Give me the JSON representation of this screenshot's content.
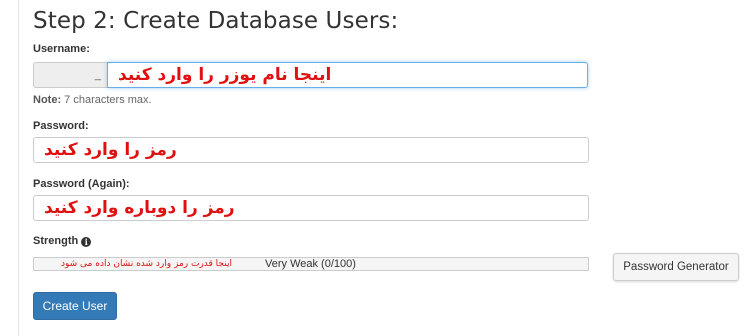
{
  "heading": "Step 2: Create Database Users:",
  "username": {
    "label": "Username:",
    "prefix": "_",
    "value": "اینجا نام یوزر را وارد کنید",
    "note_bold": "Note:",
    "note_text": " 7 characters max."
  },
  "password": {
    "label": "Password:",
    "value": "رمز را وارد کنید"
  },
  "password_again": {
    "label": "Password (Again):",
    "value": "رمز را دوباره وارد کنید"
  },
  "strength": {
    "label": "Strength",
    "info_icon": "info-circle-icon",
    "hint": "اینجا قدرت رمز وارد شده نشان داده می شود",
    "text": "Very Weak (0/100)",
    "level": 0
  },
  "buttons": {
    "generator": "Password Generator",
    "create": "Create User"
  }
}
